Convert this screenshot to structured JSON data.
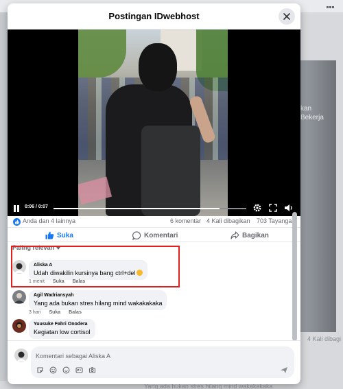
{
  "dialog": {
    "title": "Postingan IDwebhost",
    "close_icon": "close-icon"
  },
  "video": {
    "current_time": "0:06",
    "duration": "0:07",
    "time_label": "0:06 / 0:07",
    "progress_fraction": 0.86,
    "playing": true
  },
  "stats": {
    "reactions": "Anda dan 4 lainnya",
    "comments": "6 komentar",
    "shares": "4 Kali dibagikan",
    "views": "703 Tayangan"
  },
  "actions": {
    "like": "Suka",
    "comment": "Komentari",
    "share": "Bagikan"
  },
  "sort": {
    "label": "Paling relevan"
  },
  "comments": [
    {
      "name": "Aliska A",
      "text": "Udah diwakilin kursinya bang ctrl+del",
      "time": "1 menit",
      "like": "Suka",
      "reply": "Balas",
      "avatar_color": "#d9d9d9"
    },
    {
      "name": "Agil Wadriansyah",
      "text": "Yang ada bukan stres hilang mind wakakakaka",
      "time": "3 hari",
      "like": "Suka",
      "reply": "Balas",
      "avatar_color": "#7b7e82"
    },
    {
      "name": "Yuusuke Fahri Onodera",
      "text": "Kegiatan low cortisol",
      "avatar_color": "#6b2b1e"
    }
  ],
  "composer": {
    "placeholder": "Komentari sebagai Aliska A",
    "tools": [
      "sticker-icon",
      "gif-face-icon",
      "emoji-icon",
      "gif-icon",
      "camera-icon"
    ]
  },
  "background": {
    "overlay_text": "kan\nBekerja",
    "share_count": "4 Kali dibagi",
    "bottom_text": "Yang ada bukan stres hilang mind wakakakaka"
  },
  "colors": {
    "accent": "#1877f2",
    "highlight": "#e0201c",
    "bubble": "#f0f2f5",
    "muted": "#65676b"
  }
}
